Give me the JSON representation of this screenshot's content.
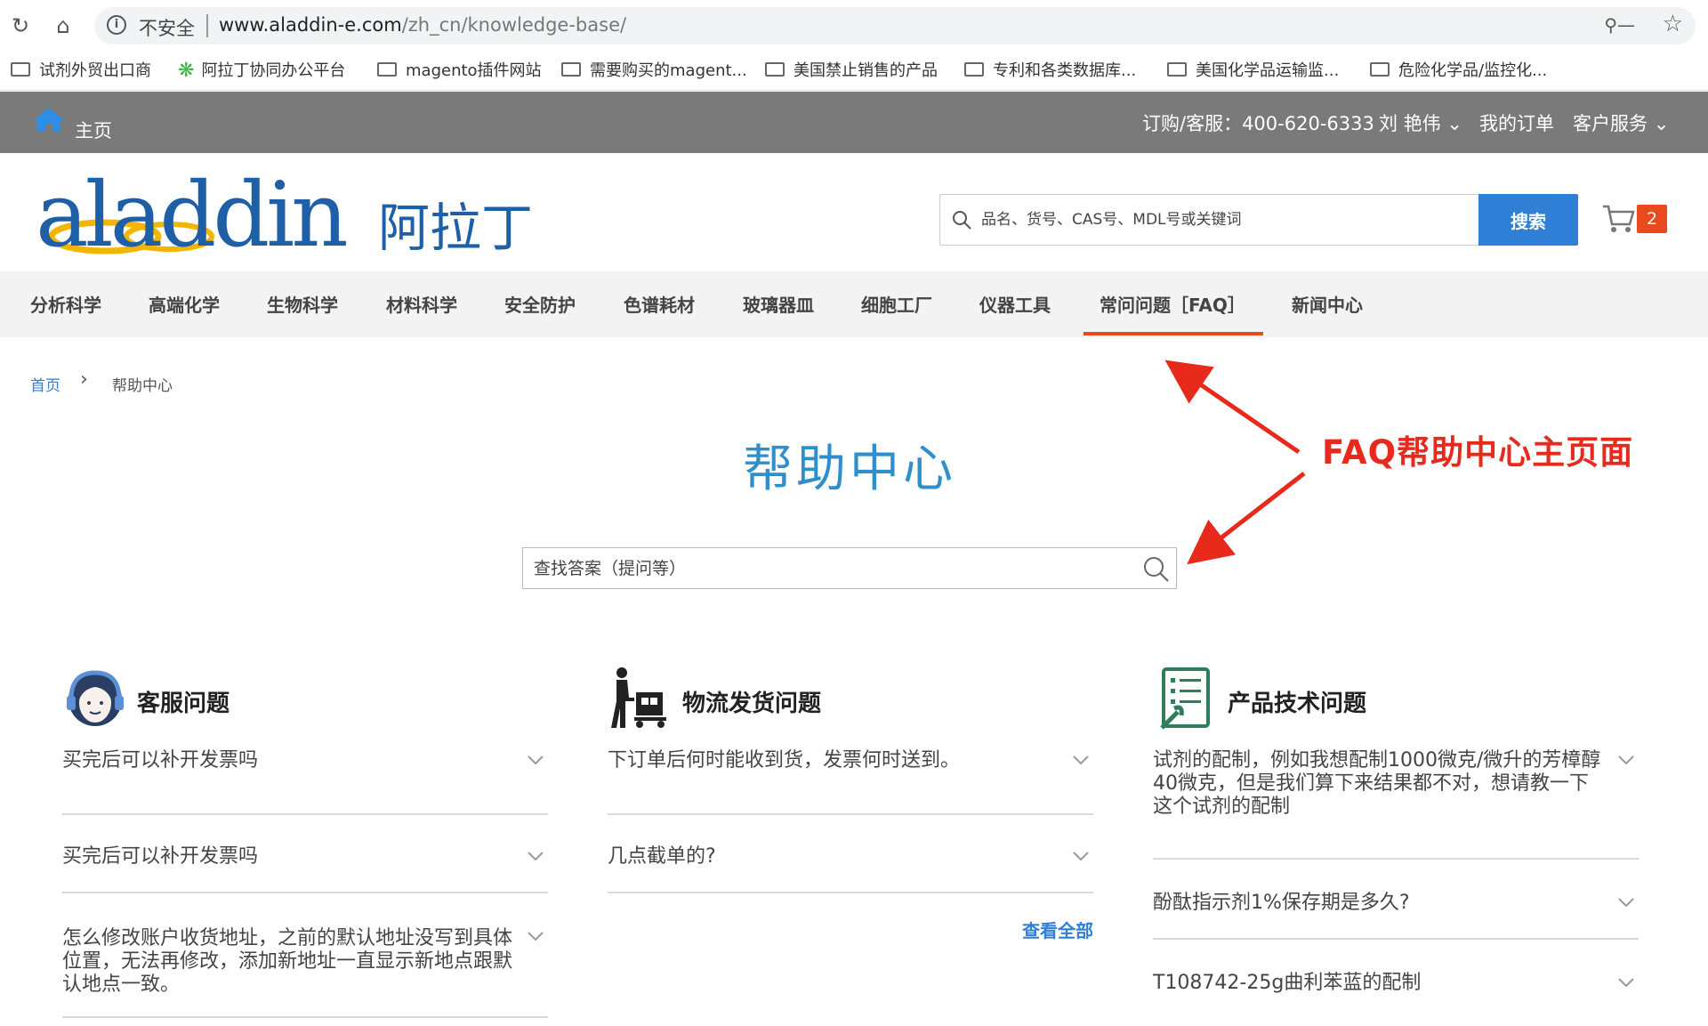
{
  "browser": {
    "security_label": "不安全",
    "url_host": "www.aladdin-e.com",
    "url_path": "/zh_cn/knowledge-base/"
  },
  "bookmarks": [
    {
      "label": "试剂外贸出口商",
      "icon": "folder-icon"
    },
    {
      "label": "阿拉丁协同办公平台",
      "icon": "gear-icon"
    },
    {
      "label": "magento插件网站",
      "icon": "folder-icon"
    },
    {
      "label": "需要购买的magent...",
      "icon": "folder-icon"
    },
    {
      "label": "美国禁止销售的产品",
      "icon": "folder-icon"
    },
    {
      "label": "专利和各类数据库...",
      "icon": "folder-icon"
    },
    {
      "label": "美国化学品运输监...",
      "icon": "folder-icon"
    },
    {
      "label": "危险化学品/监控化...",
      "icon": "folder-icon"
    }
  ],
  "topbar": {
    "home_label": "主页",
    "phone": "订购/客服：400-620-6333",
    "user": "刘 艳伟",
    "orders": "我的订单",
    "service": "客户服务"
  },
  "header": {
    "logo_en": "aladdin",
    "logo_cn": "阿拉丁",
    "search_placeholder": "品名、货号、CAS号、MDL号或关键词",
    "search_button": "搜索",
    "cart_count": "2"
  },
  "categories": [
    "分析科学",
    "高端化学",
    "生物科学",
    "材料科学",
    "安全防护",
    "色谱耗材",
    "玻璃器皿",
    "细胞工厂",
    "仪器工具",
    "常问问题［FAQ］",
    "新闻中心"
  ],
  "breadcrumb": {
    "home": "首页",
    "current": "帮助中心"
  },
  "page_title": "帮助中心",
  "faq_search_placeholder": "查找答案（提问等）",
  "annotation": "FAQ帮助中心主页面",
  "columns": [
    {
      "title": "客服问题",
      "icon": "customer-service-icon",
      "items": [
        "买完后可以补开发票吗",
        "买完后可以补开发票吗",
        "怎么修改账户收货地址，之前的默认地址没写到具体位置，无法再修改，添加新地址一直显示新地点跟默认地点一致。"
      ]
    },
    {
      "title": "物流发货问题",
      "icon": "delivery-icon",
      "items": [
        "下订单后何时能收到货，发票何时送到。",
        "几点截单的?"
      ],
      "view_all": "查看全部"
    },
    {
      "title": "产品技术问题",
      "icon": "tech-checklist-icon",
      "items": [
        "试剂的配制，例如我想配制1000微克/微升的芳樟醇40微克，但是我们算下来结果都不对，想请教一下这个试剂的配制",
        "酚酞指示剂1%保存期是多久?",
        "T108742-25g曲利苯蓝的配制"
      ]
    }
  ],
  "colors": {
    "accent_blue": "#2f7fd6",
    "title_blue": "#2f8fca",
    "active_orange": "#e8491d",
    "annotation_red": "#e82a1d",
    "topbar_gray": "#7a7a7a"
  }
}
